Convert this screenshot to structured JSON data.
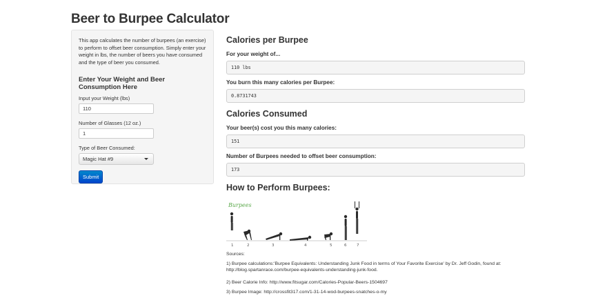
{
  "app": {
    "title": "Beer to Burpee Calculator"
  },
  "sidebar": {
    "description": "This app calculates the number of burpees (an exercise) to perform to offset beer consumption. Simply enter your weight in lbs, the number of beers you have consumed and the type of beer you consumed.",
    "section_heading": "Enter Your Weight and Beer Consumption Here",
    "weight_label": "Input your Weight (lbs)",
    "weight_value": "110",
    "glasses_label": "Number of Glasses (12 oz.)",
    "glasses_value": "1",
    "beer_type_label": "Type of Beer Consumed:",
    "beer_type_selected": "Magic Hat #9",
    "submit_label": "Submit"
  },
  "main": {
    "calories_per_burpee_heading": "Calories per Burpee",
    "weight_output_label": "For your weight of...",
    "weight_output_value": "110 lbs",
    "burn_label": "You burn this many calories per Burpee:",
    "burn_value": "0.8731743",
    "calories_consumed_heading": "Calories Consumed",
    "beer_cost_label": "Your beer(s) cost you this many calories:",
    "beer_cost_value": "151",
    "burpees_needed_label": "Number of Burpees needed to offset beer consumption:",
    "burpees_needed_value": "173",
    "how_to_heading": "How to Perform Burpees:",
    "image_caption": "Burpees",
    "step_numbers": [
      "1",
      "2",
      "3",
      "4",
      "5",
      "6",
      "7"
    ],
    "sources_label": "Sources:",
    "source_1": "1) Burpee calculations:'Burpee Equivalents: Understanding Junk Food in terms of Your Favorite Exercise' by Dr. Jeff Godin, found at: http://blog.spartanrace.com/burpee-equivalents-understanding-junk-food.",
    "source_2": "2) Beer Calorie Info: http://www.fitsugar.com/Calories-Popular-Beers-1504697",
    "source_3": "3) Burpee Image: http://crossfit317.com/1-31-14-wod-burpees-snatches-o-my"
  }
}
